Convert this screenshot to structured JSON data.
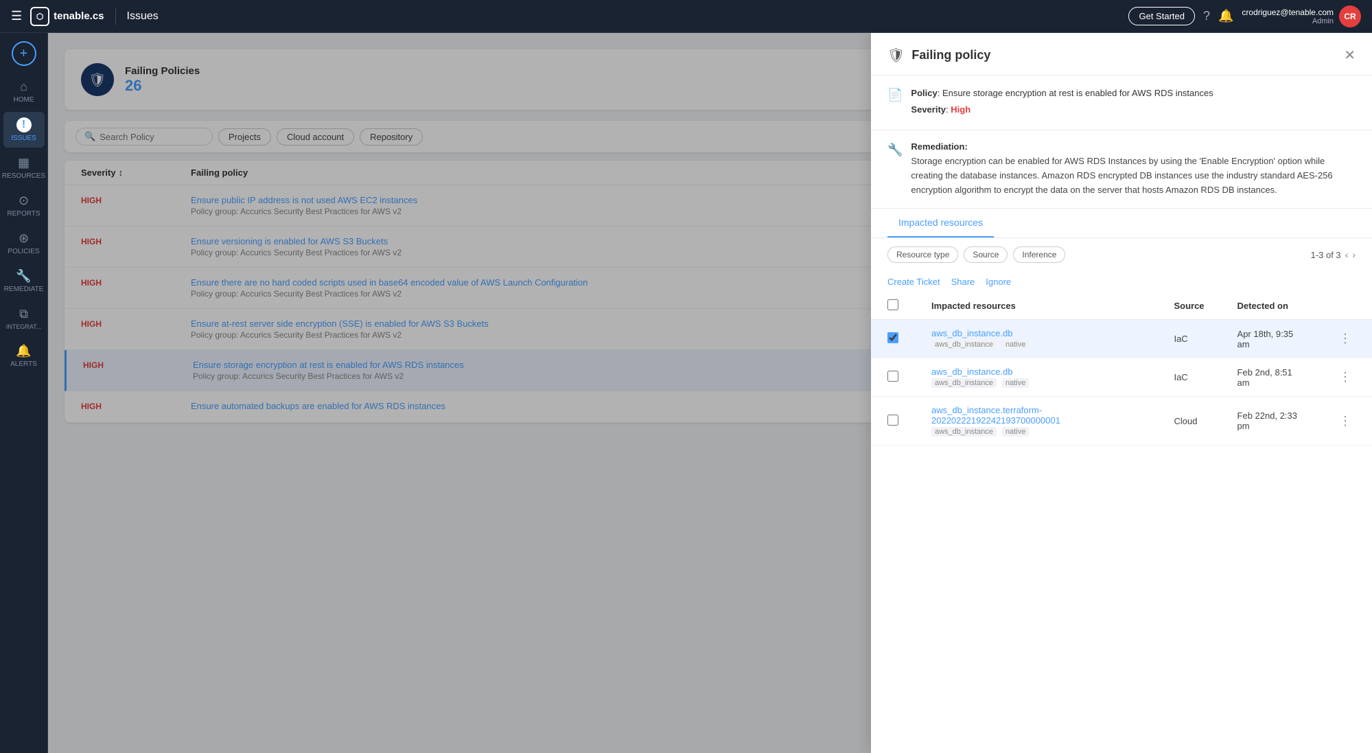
{
  "topnav": {
    "menu_icon": "☰",
    "logo_icon": "⬡",
    "logo_text": "tenable.cs",
    "divider": "|",
    "page_title": "Issues",
    "btn_get_started": "Get Started",
    "help_icon": "?",
    "bell_icon": "🔔",
    "user_email": "crodriguez@tenable.com",
    "user_role": "Admin",
    "user_initials": "CR"
  },
  "sidebar": {
    "add_icon": "+",
    "items": [
      {
        "id": "home",
        "icon": "⌂",
        "label": "HOME"
      },
      {
        "id": "issues",
        "icon": "!",
        "label": "ISSUES",
        "active": true
      },
      {
        "id": "resources",
        "icon": "▦",
        "label": "RESOURCES"
      },
      {
        "id": "reports",
        "icon": "⊙",
        "label": "REPORTS"
      },
      {
        "id": "policies",
        "icon": "⊛",
        "label": "POLICIES"
      },
      {
        "id": "remediate",
        "icon": "🔧",
        "label": "REMEDIATE"
      },
      {
        "id": "integrations",
        "icon": "⧉",
        "label": "INTEGRAT..."
      },
      {
        "id": "alerts",
        "icon": "🔔",
        "label": "ALERTS"
      }
    ]
  },
  "failing_policies": {
    "icon": "🛡",
    "title": "Failing Policies",
    "count": "26"
  },
  "filters": {
    "search_placeholder": "Search Policy",
    "buttons": [
      "Projects",
      "Cloud account",
      "Repository"
    ]
  },
  "table": {
    "columns": [
      "Severity",
      "Failing policy"
    ],
    "rows": [
      {
        "severity": "HIGH",
        "policy_name": "Ensure public IP address is not used AWS EC2 instances",
        "policy_group": "Policy group: Accurics Security Best Practices for AWS v2",
        "active": false
      },
      {
        "severity": "HIGH",
        "policy_name": "Ensure versioning is enabled for AWS S3 Buckets",
        "policy_group": "Policy group: Accurics Security Best Practices for AWS v2",
        "active": false
      },
      {
        "severity": "HIGH",
        "policy_name": "Ensure there are no hard coded scripts used in base64 encoded value of AWS Launch Configuration",
        "policy_group": "Policy group: Accurics Security Best Practices for AWS v2",
        "active": false
      },
      {
        "severity": "HIGH",
        "policy_name": "Ensure at-rest server side encryption (SSE) is enabled for AWS S3 Buckets",
        "policy_group": "Policy group: Accurics Security Best Practices for AWS v2",
        "active": false
      },
      {
        "severity": "HIGH",
        "policy_name": "Ensure storage encryption at rest is enabled for AWS RDS instances",
        "policy_group": "Policy group: Accurics Security Best Practices for AWS v2",
        "active": true
      },
      {
        "severity": "HIGH",
        "policy_name": "Ensure automated backups are enabled for AWS RDS instances",
        "policy_group": "",
        "active": false
      }
    ]
  },
  "right_panel": {
    "title": "Failing policy",
    "shield_icon": "🛡",
    "close_icon": "✕",
    "policy_icon": "📄",
    "policy_label": "Policy",
    "policy_text": "Ensure storage encryption at rest is enabled for AWS RDS instances",
    "severity_label": "Severity",
    "severity_value": "High",
    "remediation_icon": "🔧",
    "remediation_label": "Remediation",
    "remediation_text": "Storage encryption can be enabled for AWS RDS Instances by using the 'Enable Encryption' option while creating the database instances. Amazon RDS encrypted DB instances use the industry standard AES-256 encryption algorithm to encrypt the data on the server that hosts Amazon RDS DB instances.",
    "tabs": [
      "Impacted resources"
    ],
    "active_tab": "Impacted resources",
    "filter_chips": [
      "Resource type",
      "Source",
      "Inference"
    ],
    "pagination": "1-3 of 3",
    "action_links": [
      "Create Ticket",
      "Share",
      "Ignore"
    ],
    "table_columns": [
      "Impacted resources",
      "Source",
      "Detected on"
    ],
    "resources": [
      {
        "name": "aws_db_instance.db",
        "tags": [
          "aws_db_instance",
          "native"
        ],
        "source": "IaC",
        "detected_on": "Apr 18th, 9:35 am",
        "selected": true
      },
      {
        "name": "aws_db_instance.db",
        "tags": [
          "aws_db_instance",
          "native"
        ],
        "source": "IaC",
        "detected_on": "Feb 2nd, 8:51 am",
        "selected": false
      },
      {
        "name": "aws_db_instance.terraform-20220222192242193700000001",
        "tags": [
          "aws_db_instance",
          "native"
        ],
        "source": "Cloud",
        "detected_on": "Feb 22nd, 2:33 pm",
        "selected": false
      }
    ]
  }
}
